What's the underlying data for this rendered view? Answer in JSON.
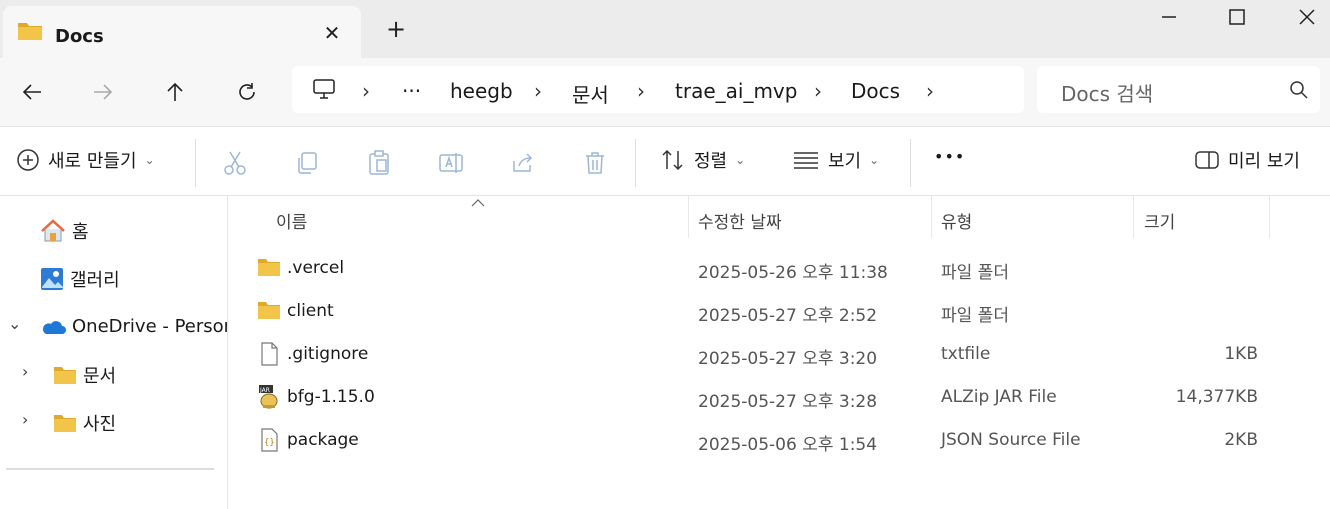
{
  "tab": {
    "title": "Docs",
    "close_glyph": "✕"
  },
  "newtab_glyph": "+",
  "nav": {
    "crumbs": [
      "heegb",
      "문서",
      "trae_ai_mvp",
      "Docs"
    ],
    "ellipsis": "···",
    "separator": "›"
  },
  "search": {
    "placeholder": "Docs 검색"
  },
  "commands": {
    "new_label": "새로 만들기",
    "sort_label": "정렬",
    "view_label": "보기",
    "more_label": "•••",
    "preview_label": "미리 보기",
    "caret": "⌄"
  },
  "sidebar": {
    "home": "홈",
    "gallery": "갤러리",
    "onedrive": "OneDrive - Personal",
    "documents": "문서",
    "pictures": "사진",
    "chev_right": "›",
    "chev_down": "⌄"
  },
  "columns": {
    "name": "이름",
    "date": "수정한 날짜",
    "type": "유형",
    "size": "크기"
  },
  "files": [
    {
      "name": ".vercel",
      "date": "2025-05-26 오후 11:38",
      "type": "파일 폴더",
      "size": "",
      "icon": "folder-icon"
    },
    {
      "name": "client",
      "date": "2025-05-27 오후 2:52",
      "type": "파일 폴더",
      "size": "",
      "icon": "folder-icon"
    },
    {
      "name": ".gitignore",
      "date": "2025-05-27 오후 3:20",
      "type": "txtfile",
      "size": "1KB",
      "icon": "file-icon"
    },
    {
      "name": "bfg-1.15.0",
      "date": "2025-05-27 오후 3:28",
      "type": "ALZip JAR File",
      "size": "14,377KB",
      "icon": "jar-icon"
    },
    {
      "name": "package",
      "date": "2025-05-06 오후 1:54",
      "type": "JSON Source File",
      "size": "2KB",
      "icon": "json-icon"
    }
  ],
  "colors": {
    "folder": "#f3c44a",
    "folder_dark": "#e0a92a",
    "onedrive": "#1e78d6",
    "home_roof": "#e86a3a"
  }
}
